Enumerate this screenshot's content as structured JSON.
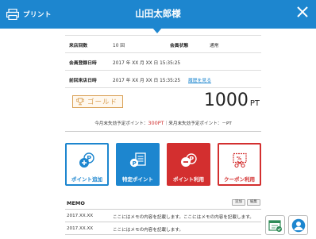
{
  "header": {
    "print_label": "プリント",
    "title": "山田太郎様",
    "icons": {
      "print": "printer-icon",
      "close": "close-icon"
    }
  },
  "info": {
    "visits_label": "来店回数",
    "visits_value": "10 回",
    "status_label": "会員状態",
    "status_value": "通常",
    "registered_label": "会員登録日時",
    "registered_value": "2017 年 XX 月 XX 日 15:35:25",
    "last_visit_label": "前回来店日時",
    "last_visit_value": "2017 年 XX 月 XX 日 15:35:25",
    "history_link": "履歴を見る"
  },
  "rank": {
    "label": "ゴールド",
    "icon": "trophy-icon"
  },
  "points": {
    "value": "1000",
    "unit": "PT"
  },
  "expiry": {
    "this_month_label": "今月末失効予定ポイント：",
    "this_month_value": "300PT",
    "separator": "｜",
    "next_month_label": "来月末失効予定ポイント：",
    "next_month_value": "－PT"
  },
  "actions": {
    "add_points": "ポイント追加",
    "specific_points": "特定ポイント",
    "use_points": "ポイント利用",
    "use_coupon": "クーポン利用"
  },
  "memo": {
    "title": "MEMO",
    "add_label": "追加",
    "edit_label": "編集",
    "rows": [
      {
        "date": "2017.XX.XX",
        "text": "ここにはメモの内容を記載します。ここにはメモの内容を記載します。"
      },
      {
        "date": "2017.XX.XX",
        "text": "ここにはメモの内容を記載します。"
      }
    ]
  },
  "colors": {
    "brand_blue": "#1d86cf",
    "danger_red": "#d32f2f",
    "gold": "#d9a055",
    "highlight_red": "#d02e2e"
  }
}
